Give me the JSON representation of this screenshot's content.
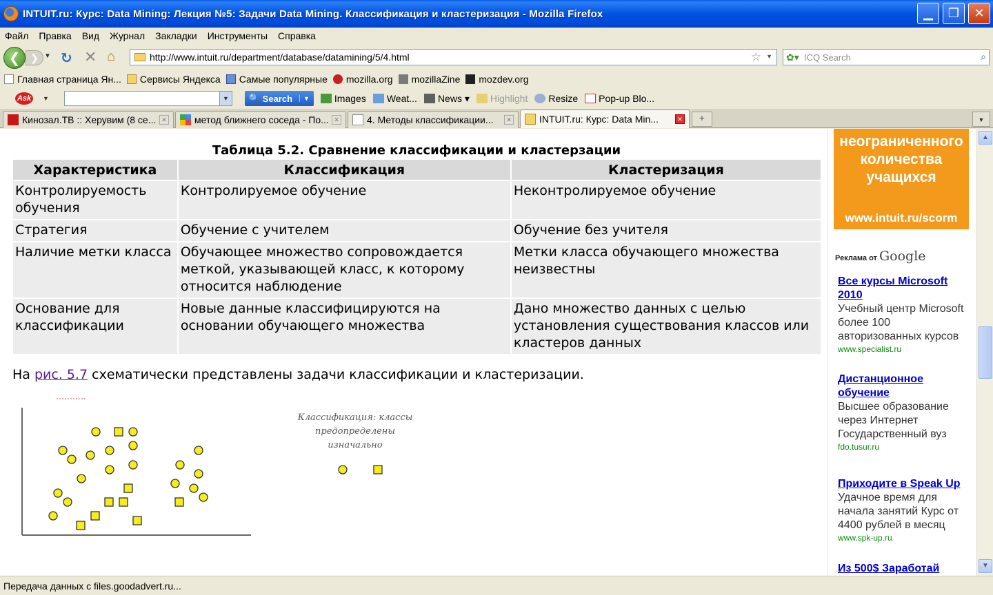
{
  "window": {
    "title": "INTUIT.ru: Курс: Data Mining: Лекция №5: Задачи Data Mining. Классификация и кластеризация - Mozilla Firefox",
    "min_glyph": "▁",
    "max_glyph": "❐",
    "close_glyph": "✕"
  },
  "menu": [
    "Файл",
    "Правка",
    "Вид",
    "Журнал",
    "Закладки",
    "Инструменты",
    "Справка"
  ],
  "nav": {
    "url": "http://www.intuit.ru/department/database/datamining/5/4.html",
    "search_placeholder": "ICQ Search",
    "icons": {
      "back": "back-arrow-icon",
      "forward": "forward-arrow-icon",
      "reload": "reload-icon",
      "stop": "stop-icon",
      "home": "home-icon"
    }
  },
  "bookmarks": [
    {
      "label": "Главная страница Ян...",
      "color": "#ffffff"
    },
    {
      "label": "Сервисы Яндекса",
      "color": "#f3d36a"
    },
    {
      "label": "Самые популярные",
      "color": "#6a8ed8"
    },
    {
      "label": "mozilla.org",
      "color": "#c82020"
    },
    {
      "label": "mozillaZine",
      "color": "#7a7a7a"
    },
    {
      "label": "mozdev.org",
      "color": "#202020"
    }
  ],
  "ask": {
    "logo": "Ask",
    "search_label": "Search",
    "items": [
      "Images",
      "Weat...",
      "News",
      "Highlight",
      "Resize",
      "Pop-up Blo..."
    ]
  },
  "tabs": [
    {
      "label": "Кинозал.ТВ :: Херувим (8 се...",
      "icon_color": "#c41818"
    },
    {
      "label": "метод ближнего соседа - По...",
      "icon_color": "#3b78e7"
    },
    {
      "label": "4. Методы классификации...",
      "icon_color": "#ffffff"
    },
    {
      "label": "INTUIT.ru: Курс: Data Min...",
      "icon_color": "#f3d36a"
    }
  ],
  "article": {
    "table_caption": "Таблица 5.2. Сравнение классификации и кластерзации",
    "headers": [
      "Характеристика",
      "Классификация",
      "Кластеризация"
    ],
    "rows": [
      [
        "Контролируемость обучения",
        "Контролируемое обучение",
        "Неконтролируемое обучение"
      ],
      [
        "Стратегия",
        "Обучение с учителем",
        "Обучение без учителя"
      ],
      [
        "Наличие метки класса",
        "Обучающее множество сопровождается меткой, указывающей класс, к которому относится наблюдение",
        "Метки класса обучающего множества неизвестны"
      ],
      [
        "Основание для классификации",
        "Новые данные классифицируются на основании обучающего множества",
        "Дано множество данных с целью установления существования классов или кластеров данных"
      ]
    ],
    "para_before": "На ",
    "para_link": "рис. 5.7",
    "para_after": " схематически представлены задачи классификации и кластеризации.",
    "figure_caption": [
      "Классификация: классы",
      "предопределены",
      "изначально"
    ]
  },
  "sidebar": {
    "banner_lines": [
      "неограниченного",
      "количества",
      "учащихся"
    ],
    "banner_url": "www.intuit.ru/scorm",
    "ads_by": "Реклама от",
    "google": "Google",
    "ads": [
      {
        "title": "Все курсы Microsoft 2010",
        "body": "Учебный центр Microsoft более 100 авторизованных курсов",
        "url": "www.specialist.ru"
      },
      {
        "title": "Дистанционное обучение",
        "body": "Высшее образование через Интернет Государственный вуз",
        "url": "fdo.tusur.ru"
      },
      {
        "title": "Приходите в Speak Up",
        "body": "Удачное время для начала занятий Курс от 4400 рублей в месяц",
        "url": "www.spk-up.ru"
      },
      {
        "title": "Из 500$ Заработай",
        "body": "",
        "url": ""
      }
    ]
  },
  "status": "Передача данных с files.goodadvert.ru...",
  "colors": {
    "titlebar": "#0052e0",
    "banner": "#f39a1d",
    "ad_link": "#0000cc",
    "ad_url": "#088a08",
    "figure_marker": "#f7ec1e"
  }
}
